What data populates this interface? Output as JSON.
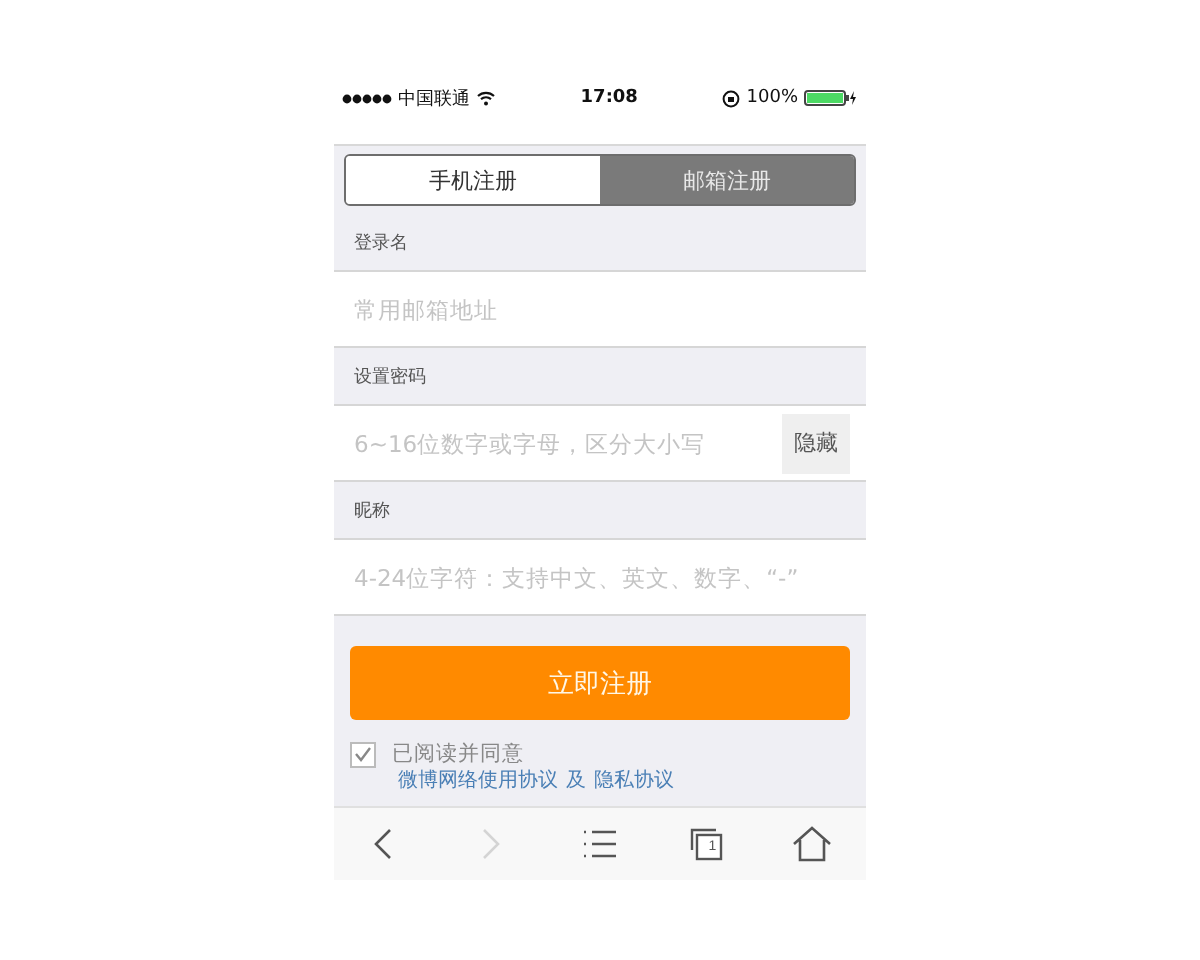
{
  "status_bar": {
    "carrier": "中国联通",
    "time": "17:08",
    "battery": "100%"
  },
  "segments": [
    {
      "label": "手机注册",
      "selected": false
    },
    {
      "label": "邮箱注册",
      "selected": true
    }
  ],
  "fields": [
    {
      "label": "登录名",
      "placeholder": "常用邮箱地址"
    },
    {
      "label": "设置密码",
      "placeholder": "6~16位数字或字母，区分大小写",
      "button": "隐藏"
    },
    {
      "label": "昵称",
      "placeholder": "4-24位字符：支持中文、英文、数字、“-”"
    }
  ],
  "submit": "立即注册",
  "agreement": {
    "checked": true,
    "text": "已阅读并同意",
    "links": [
      "微博网络使用协议",
      "隐私协议"
    ],
    "joiner": "及"
  },
  "toolbar": [
    {
      "kind": "back",
      "disabled": false
    },
    {
      "kind": "forward",
      "disabled": true
    },
    {
      "kind": "list",
      "disabled": false
    },
    {
      "kind": "tabs",
      "disabled": false,
      "count": "1"
    },
    {
      "kind": "home",
      "disabled": false
    }
  ]
}
